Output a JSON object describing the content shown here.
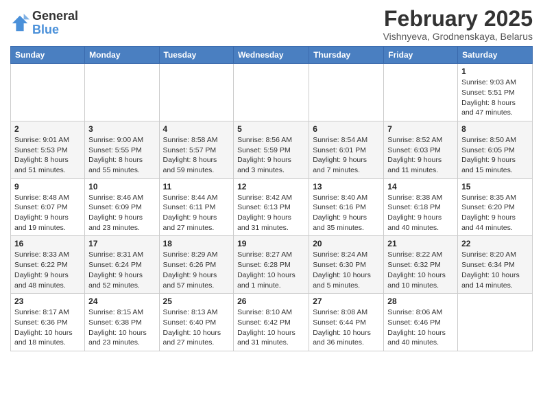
{
  "logo": {
    "general": "General",
    "blue": "Blue"
  },
  "header": {
    "month": "February 2025",
    "location": "Vishnyeva, Grodnenskaya, Belarus"
  },
  "weekdays": [
    "Sunday",
    "Monday",
    "Tuesday",
    "Wednesday",
    "Thursday",
    "Friday",
    "Saturday"
  ],
  "weeks": [
    [
      {
        "day": "",
        "info": ""
      },
      {
        "day": "",
        "info": ""
      },
      {
        "day": "",
        "info": ""
      },
      {
        "day": "",
        "info": ""
      },
      {
        "day": "",
        "info": ""
      },
      {
        "day": "",
        "info": ""
      },
      {
        "day": "1",
        "info": "Sunrise: 9:03 AM\nSunset: 5:51 PM\nDaylight: 8 hours\nand 47 minutes."
      }
    ],
    [
      {
        "day": "2",
        "info": "Sunrise: 9:01 AM\nSunset: 5:53 PM\nDaylight: 8 hours\nand 51 minutes."
      },
      {
        "day": "3",
        "info": "Sunrise: 9:00 AM\nSunset: 5:55 PM\nDaylight: 8 hours\nand 55 minutes."
      },
      {
        "day": "4",
        "info": "Sunrise: 8:58 AM\nSunset: 5:57 PM\nDaylight: 8 hours\nand 59 minutes."
      },
      {
        "day": "5",
        "info": "Sunrise: 8:56 AM\nSunset: 5:59 PM\nDaylight: 9 hours\nand 3 minutes."
      },
      {
        "day": "6",
        "info": "Sunrise: 8:54 AM\nSunset: 6:01 PM\nDaylight: 9 hours\nand 7 minutes."
      },
      {
        "day": "7",
        "info": "Sunrise: 8:52 AM\nSunset: 6:03 PM\nDaylight: 9 hours\nand 11 minutes."
      },
      {
        "day": "8",
        "info": "Sunrise: 8:50 AM\nSunset: 6:05 PM\nDaylight: 9 hours\nand 15 minutes."
      }
    ],
    [
      {
        "day": "9",
        "info": "Sunrise: 8:48 AM\nSunset: 6:07 PM\nDaylight: 9 hours\nand 19 minutes."
      },
      {
        "day": "10",
        "info": "Sunrise: 8:46 AM\nSunset: 6:09 PM\nDaylight: 9 hours\nand 23 minutes."
      },
      {
        "day": "11",
        "info": "Sunrise: 8:44 AM\nSunset: 6:11 PM\nDaylight: 9 hours\nand 27 minutes."
      },
      {
        "day": "12",
        "info": "Sunrise: 8:42 AM\nSunset: 6:13 PM\nDaylight: 9 hours\nand 31 minutes."
      },
      {
        "day": "13",
        "info": "Sunrise: 8:40 AM\nSunset: 6:16 PM\nDaylight: 9 hours\nand 35 minutes."
      },
      {
        "day": "14",
        "info": "Sunrise: 8:38 AM\nSunset: 6:18 PM\nDaylight: 9 hours\nand 40 minutes."
      },
      {
        "day": "15",
        "info": "Sunrise: 8:35 AM\nSunset: 6:20 PM\nDaylight: 9 hours\nand 44 minutes."
      }
    ],
    [
      {
        "day": "16",
        "info": "Sunrise: 8:33 AM\nSunset: 6:22 PM\nDaylight: 9 hours\nand 48 minutes."
      },
      {
        "day": "17",
        "info": "Sunrise: 8:31 AM\nSunset: 6:24 PM\nDaylight: 9 hours\nand 52 minutes."
      },
      {
        "day": "18",
        "info": "Sunrise: 8:29 AM\nSunset: 6:26 PM\nDaylight: 9 hours\nand 57 minutes."
      },
      {
        "day": "19",
        "info": "Sunrise: 8:27 AM\nSunset: 6:28 PM\nDaylight: 10 hours\nand 1 minute."
      },
      {
        "day": "20",
        "info": "Sunrise: 8:24 AM\nSunset: 6:30 PM\nDaylight: 10 hours\nand 5 minutes."
      },
      {
        "day": "21",
        "info": "Sunrise: 8:22 AM\nSunset: 6:32 PM\nDaylight: 10 hours\nand 10 minutes."
      },
      {
        "day": "22",
        "info": "Sunrise: 8:20 AM\nSunset: 6:34 PM\nDaylight: 10 hours\nand 14 minutes."
      }
    ],
    [
      {
        "day": "23",
        "info": "Sunrise: 8:17 AM\nSunset: 6:36 PM\nDaylight: 10 hours\nand 18 minutes."
      },
      {
        "day": "24",
        "info": "Sunrise: 8:15 AM\nSunset: 6:38 PM\nDaylight: 10 hours\nand 23 minutes."
      },
      {
        "day": "25",
        "info": "Sunrise: 8:13 AM\nSunset: 6:40 PM\nDaylight: 10 hours\nand 27 minutes."
      },
      {
        "day": "26",
        "info": "Sunrise: 8:10 AM\nSunset: 6:42 PM\nDaylight: 10 hours\nand 31 minutes."
      },
      {
        "day": "27",
        "info": "Sunrise: 8:08 AM\nSunset: 6:44 PM\nDaylight: 10 hours\nand 36 minutes."
      },
      {
        "day": "28",
        "info": "Sunrise: 8:06 AM\nSunset: 6:46 PM\nDaylight: 10 hours\nand 40 minutes."
      },
      {
        "day": "",
        "info": ""
      }
    ]
  ]
}
